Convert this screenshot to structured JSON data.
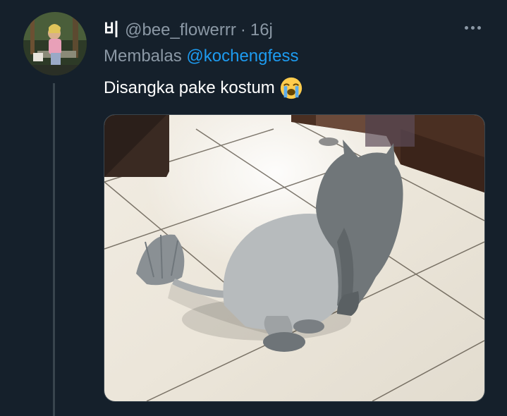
{
  "tweet": {
    "display_name": "비",
    "handle": "@bee_flowerrr",
    "separator": "·",
    "time": "16j",
    "reply_prefix": "Membalas",
    "reply_to": "@kochengfess",
    "text": "Disangka pake kostum",
    "emoji": "loudly-crying-face-icon",
    "more_icon": "more-options-icon"
  },
  "colors": {
    "background": "#15202b",
    "secondary_text": "#8b98a5",
    "link": "#1d9bf0",
    "border": "#38444d"
  }
}
